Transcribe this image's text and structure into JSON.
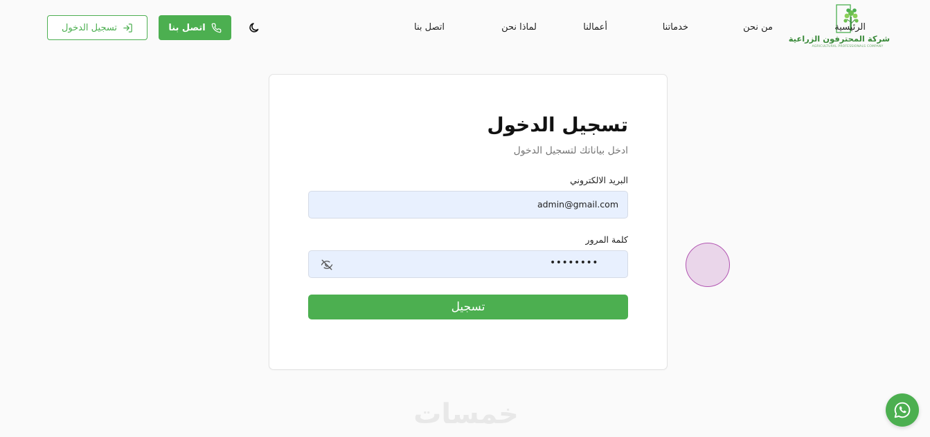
{
  "brand": {
    "name": "شركة المحترفون الزراعية",
    "subtitle": "AGRICULTURAL PROFESSIONALS COMPANY",
    "color": "#4caf50"
  },
  "nav": {
    "items": [
      {
        "label": "الرئيسية"
      },
      {
        "label": "من نحن"
      },
      {
        "label": "خدماتنا"
      },
      {
        "label": "أعمالنا"
      },
      {
        "label": "لماذا نحن"
      },
      {
        "label": "اتصل بنا"
      }
    ]
  },
  "header": {
    "contact_label": "اتصل بنا",
    "login_label": "تسجيل الدخول",
    "theme_icon": "moon-icon"
  },
  "login": {
    "title": "تسجيل الدخول",
    "subtitle": "ادخل بياناتك لتسجيل الدخول",
    "email_label": "البريد الالكتروني",
    "email_value": "admin@gmail.com",
    "password_label": "كلمة المرور",
    "password_value": "••••••••",
    "submit_label": "تسجيل"
  },
  "watermark": "خمسات"
}
